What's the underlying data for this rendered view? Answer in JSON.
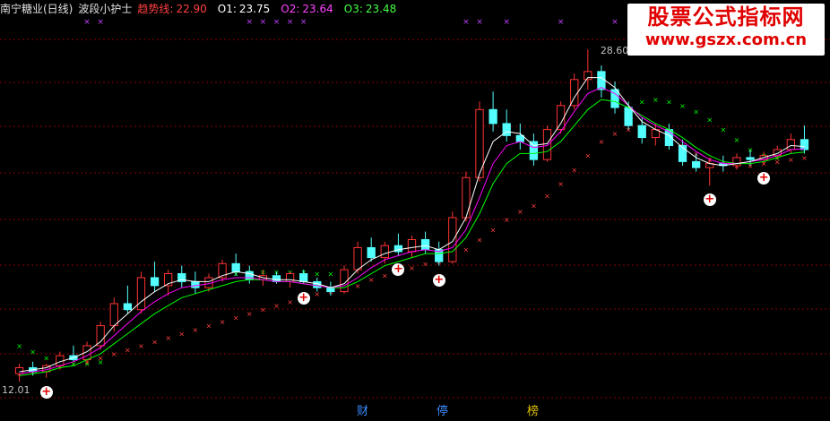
{
  "header": {
    "stock_name": "南宁糖业(日线)",
    "indicator_name": "波段小护士",
    "trend_label": "趋势线:",
    "trend_value": "22.90",
    "o1_label": "O1:",
    "o1_value": "23.75",
    "o2_label": "O2:",
    "o2_value": "23.64",
    "o3_label": "O3:",
    "o3_value": "23.48"
  },
  "watermark": {
    "title": "股票公式指标网",
    "url": "www.gszx.com.cn"
  },
  "bottom_tabs": [
    "财",
    "停",
    "榜"
  ],
  "colors": {
    "background": "#000000",
    "grid": "#8b0000",
    "up_candle": "#ff3333",
    "down_candle": "#54ffff",
    "trend_line": "#ff4040",
    "o1_line": "#ffffff",
    "o2_line": "#ff00ff",
    "o3_line": "#00ff00",
    "title": "#e0e0e0",
    "x_marks": "#c040ff",
    "tab_blue": "#3c8cff",
    "tab_yellow": "#e0c000"
  },
  "chart_data": {
    "type": "candlestick",
    "symbol": "南宁糖业",
    "period": "日线",
    "price_range": [
      11.2,
      30.0
    ],
    "annotations": {
      "high_label": "28.60",
      "low_label": "12.01"
    },
    "candles": [
      {
        "o": 12.4,
        "h": 12.9,
        "l": 12.0,
        "c": 12.7
      },
      {
        "o": 12.7,
        "h": 13.0,
        "l": 12.3,
        "c": 12.5
      },
      {
        "o": 12.5,
        "h": 12.9,
        "l": 12.2,
        "c": 12.8
      },
      {
        "o": 12.8,
        "h": 13.5,
        "l": 12.6,
        "c": 13.3
      },
      {
        "o": 13.3,
        "h": 13.8,
        "l": 13.0,
        "c": 13.1
      },
      {
        "o": 13.1,
        "h": 14.0,
        "l": 12.9,
        "c": 13.8
      },
      {
        "o": 13.8,
        "h": 15.0,
        "l": 13.6,
        "c": 14.8
      },
      {
        "o": 14.8,
        "h": 16.2,
        "l": 14.5,
        "c": 15.9
      },
      {
        "o": 15.9,
        "h": 16.8,
        "l": 15.4,
        "c": 15.6
      },
      {
        "o": 15.6,
        "h": 17.5,
        "l": 15.4,
        "c": 17.2
      },
      {
        "o": 17.2,
        "h": 18.0,
        "l": 16.5,
        "c": 16.8
      },
      {
        "o": 16.8,
        "h": 17.6,
        "l": 16.3,
        "c": 17.4
      },
      {
        "o": 17.4,
        "h": 17.8,
        "l": 16.7,
        "c": 17.0
      },
      {
        "o": 17.0,
        "h": 17.5,
        "l": 16.4,
        "c": 16.7
      },
      {
        "o": 16.7,
        "h": 17.4,
        "l": 16.5,
        "c": 17.2
      },
      {
        "o": 17.2,
        "h": 18.1,
        "l": 17.0,
        "c": 17.9
      },
      {
        "o": 17.9,
        "h": 18.4,
        "l": 17.3,
        "c": 17.5
      },
      {
        "o": 17.5,
        "h": 17.8,
        "l": 16.9,
        "c": 17.1
      },
      {
        "o": 17.1,
        "h": 17.6,
        "l": 16.8,
        "c": 17.3
      },
      {
        "o": 17.3,
        "h": 17.5,
        "l": 16.9,
        "c": 17.0
      },
      {
        "o": 17.0,
        "h": 17.5,
        "l": 16.7,
        "c": 17.4
      },
      {
        "o": 17.4,
        "h": 17.6,
        "l": 16.9,
        "c": 17.0
      },
      {
        "o": 17.0,
        "h": 17.2,
        "l": 16.5,
        "c": 16.7
      },
      {
        "o": 16.7,
        "h": 17.0,
        "l": 16.3,
        "c": 16.5
      },
      {
        "o": 16.5,
        "h": 17.8,
        "l": 16.4,
        "c": 17.6
      },
      {
        "o": 17.6,
        "h": 19.0,
        "l": 17.4,
        "c": 18.7
      },
      {
        "o": 18.7,
        "h": 19.2,
        "l": 18.0,
        "c": 18.2
      },
      {
        "o": 18.2,
        "h": 19.0,
        "l": 17.9,
        "c": 18.8
      },
      {
        "o": 18.8,
        "h": 19.4,
        "l": 18.3,
        "c": 18.5
      },
      {
        "o": 18.5,
        "h": 19.3,
        "l": 18.2,
        "c": 19.1
      },
      {
        "o": 19.1,
        "h": 19.5,
        "l": 18.4,
        "c": 18.6
      },
      {
        "o": 18.6,
        "h": 19.0,
        "l": 17.8,
        "c": 18.0
      },
      {
        "o": 18.0,
        "h": 20.5,
        "l": 17.9,
        "c": 20.2
      },
      {
        "o": 20.2,
        "h": 22.5,
        "l": 20.0,
        "c": 22.2
      },
      {
        "o": 22.2,
        "h": 26.0,
        "l": 22.0,
        "c": 25.6
      },
      {
        "o": 25.6,
        "h": 26.5,
        "l": 24.5,
        "c": 24.9
      },
      {
        "o": 24.9,
        "h": 25.6,
        "l": 24.0,
        "c": 24.3
      },
      {
        "o": 24.3,
        "h": 24.9,
        "l": 23.6,
        "c": 24.0
      },
      {
        "o": 24.0,
        "h": 24.4,
        "l": 22.8,
        "c": 23.1
      },
      {
        "o": 23.1,
        "h": 24.8,
        "l": 23.0,
        "c": 24.6
      },
      {
        "o": 24.6,
        "h": 26.0,
        "l": 24.4,
        "c": 25.8
      },
      {
        "o": 25.8,
        "h": 27.4,
        "l": 25.6,
        "c": 27.1
      },
      {
        "o": 27.1,
        "h": 28.6,
        "l": 26.6,
        "c": 27.5
      },
      {
        "o": 27.5,
        "h": 27.8,
        "l": 26.2,
        "c": 26.6
      },
      {
        "o": 26.6,
        "h": 27.0,
        "l": 25.4,
        "c": 25.7
      },
      {
        "o": 25.7,
        "h": 26.0,
        "l": 24.6,
        "c": 24.8
      },
      {
        "o": 24.8,
        "h": 25.2,
        "l": 23.9,
        "c": 24.2
      },
      {
        "o": 24.2,
        "h": 24.9,
        "l": 23.8,
        "c": 24.6
      },
      {
        "o": 24.6,
        "h": 24.9,
        "l": 23.6,
        "c": 23.8
      },
      {
        "o": 23.8,
        "h": 24.1,
        "l": 22.8,
        "c": 23.0
      },
      {
        "o": 23.0,
        "h": 23.4,
        "l": 22.5,
        "c": 22.7
      },
      {
        "o": 22.7,
        "h": 23.2,
        "l": 21.8,
        "c": 22.9
      },
      {
        "o": 22.9,
        "h": 23.3,
        "l": 22.5,
        "c": 22.8
      },
      {
        "o": 22.8,
        "h": 23.4,
        "l": 22.6,
        "c": 23.2
      },
      {
        "o": 23.2,
        "h": 23.6,
        "l": 22.8,
        "c": 23.1
      },
      {
        "o": 23.1,
        "h": 23.5,
        "l": 22.9,
        "c": 23.3
      },
      {
        "o": 23.3,
        "h": 23.8,
        "l": 23.1,
        "c": 23.6
      },
      {
        "o": 23.6,
        "h": 24.4,
        "l": 23.4,
        "c": 24.1
      },
      {
        "o": 24.1,
        "h": 24.8,
        "l": 23.4,
        "c": 23.6
      }
    ],
    "trend_line": [
      12.4,
      12.5,
      12.6,
      12.8,
      12.9,
      13.0,
      13.2,
      13.4,
      13.6,
      13.8,
      14.0,
      14.2,
      14.4,
      14.6,
      14.8,
      15.0,
      15.2,
      15.4,
      15.6,
      15.8,
      16.0,
      16.2,
      16.4,
      16.5,
      16.6,
      16.8,
      17.1,
      17.3,
      17.5,
      17.7,
      17.9,
      18.0,
      18.2,
      18.6,
      19.1,
      19.6,
      20.1,
      20.5,
      20.8,
      21.3,
      21.9,
      22.6,
      23.3,
      24.0,
      24.4,
      24.6,
      24.6,
      24.4,
      24.1,
      23.8,
      23.4,
      23.1,
      22.9,
      22.8,
      22.8,
      22.9,
      23.0,
      23.1,
      23.2
    ],
    "o1_line": [
      12.5,
      12.6,
      12.7,
      13.0,
      13.2,
      13.5,
      14.0,
      14.8,
      15.4,
      16.0,
      16.5,
      16.9,
      17.1,
      17.0,
      17.0,
      17.3,
      17.5,
      17.4,
      17.2,
      17.1,
      17.1,
      17.0,
      16.9,
      16.7,
      16.9,
      17.6,
      18.1,
      18.4,
      18.6,
      18.7,
      18.8,
      18.6,
      19.0,
      20.2,
      22.4,
      24.0,
      24.5,
      24.4,
      23.8,
      23.9,
      24.9,
      26.2,
      27.2,
      27.2,
      26.7,
      25.8,
      25.0,
      24.6,
      24.3,
      23.7,
      23.2,
      22.9,
      22.8,
      22.9,
      23.0,
      23.2,
      23.4,
      23.8,
      23.75
    ],
    "o2_line": [
      12.4,
      12.5,
      12.6,
      12.8,
      13.0,
      13.3,
      13.7,
      14.3,
      14.9,
      15.5,
      16.0,
      16.4,
      16.7,
      16.8,
      16.9,
      17.1,
      17.2,
      17.2,
      17.1,
      17.0,
      17.0,
      16.9,
      16.8,
      16.7,
      16.8,
      17.2,
      17.7,
      18.1,
      18.3,
      18.5,
      18.6,
      18.5,
      18.7,
      19.6,
      21.2,
      22.9,
      23.8,
      24.0,
      23.7,
      23.8,
      24.5,
      25.5,
      26.4,
      26.7,
      26.4,
      25.8,
      25.2,
      24.8,
      24.5,
      24.0,
      23.5,
      23.1,
      22.9,
      22.9,
      23.0,
      23.1,
      23.3,
      23.6,
      23.64
    ],
    "o3_line": [
      12.3,
      12.4,
      12.5,
      12.7,
      12.8,
      13.1,
      13.4,
      13.9,
      14.4,
      14.9,
      15.4,
      15.8,
      16.2,
      16.4,
      16.6,
      16.8,
      17.0,
      17.1,
      17.1,
      17.0,
      17.0,
      16.9,
      16.8,
      16.7,
      16.7,
      17.0,
      17.4,
      17.8,
      18.0,
      18.2,
      18.4,
      18.4,
      18.5,
      19.2,
      20.4,
      21.9,
      22.9,
      23.4,
      23.4,
      23.5,
      24.0,
      24.8,
      25.6,
      26.1,
      26.0,
      25.7,
      25.3,
      24.9,
      24.6,
      24.2,
      23.7,
      23.3,
      23.0,
      22.9,
      22.9,
      23.0,
      23.2,
      23.4,
      23.48
    ],
    "green_dots": [
      13.8,
      13.5,
      13.2,
      13.0,
      12.9,
      12.9,
      13.0,
      null,
      null,
      null,
      null,
      null,
      null,
      null,
      null,
      null,
      17.4,
      17.5,
      17.5,
      17.5,
      17.5,
      17.5,
      17.4,
      17.4,
      null,
      null,
      null,
      null,
      null,
      null,
      null,
      null,
      null,
      null,
      null,
      null,
      null,
      null,
      null,
      null,
      null,
      null,
      null,
      null,
      null,
      25.7,
      26.0,
      26.1,
      26.0,
      25.8,
      25.5,
      25.1,
      24.6,
      24.1,
      23.6,
      23.3,
      23.2,
      null,
      null
    ],
    "buy_signal_indices": [
      2,
      21,
      28,
      31,
      51,
      55
    ],
    "sell_x_mark_indices": [
      5,
      6,
      17,
      18,
      19,
      20,
      21,
      33,
      34,
      36,
      40,
      44,
      46,
      50
    ]
  }
}
